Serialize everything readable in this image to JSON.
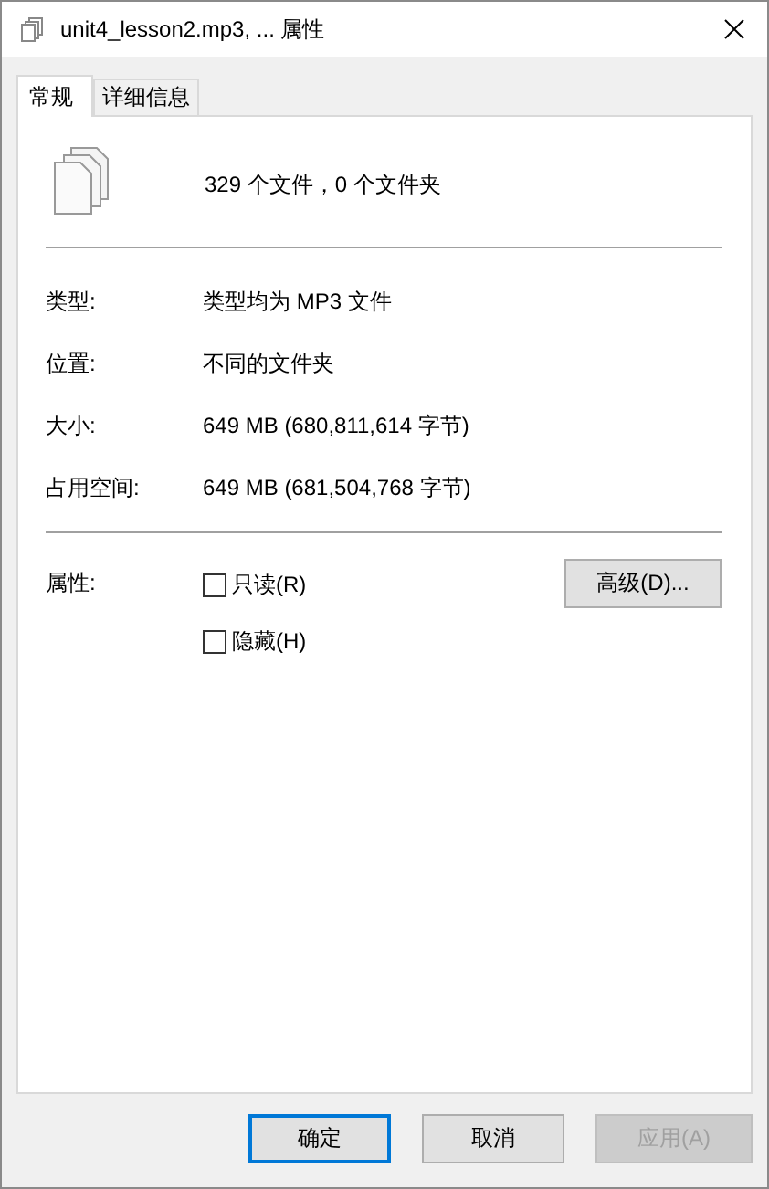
{
  "window": {
    "title": "unit4_lesson2.mp3, ... 属性"
  },
  "tabs": [
    {
      "label": "常规",
      "selected": true
    },
    {
      "label": "详细信息",
      "selected": false
    }
  ],
  "summary": "329 个文件，0 个文件夹",
  "properties": [
    {
      "label": "类型:",
      "value": "类型均为 MP3 文件"
    },
    {
      "label": "位置:",
      "value": "不同的文件夹"
    },
    {
      "label": "大小:",
      "value": "649 MB (680,811,614 字节)"
    },
    {
      "label": "占用空间:",
      "value": "649 MB (681,504,768 字节)"
    }
  ],
  "attributes": {
    "label": "属性:",
    "checkboxes": [
      {
        "label": "只读(R)",
        "checked": false
      },
      {
        "label": "隐藏(H)",
        "checked": false
      }
    ],
    "advanced_button": "高级(D)..."
  },
  "buttons": [
    {
      "label": "确定",
      "kind": "default",
      "disabled": false
    },
    {
      "label": "取消",
      "kind": "normal",
      "disabled": false
    },
    {
      "label": "应用(A)",
      "kind": "normal",
      "disabled": true
    }
  ]
}
